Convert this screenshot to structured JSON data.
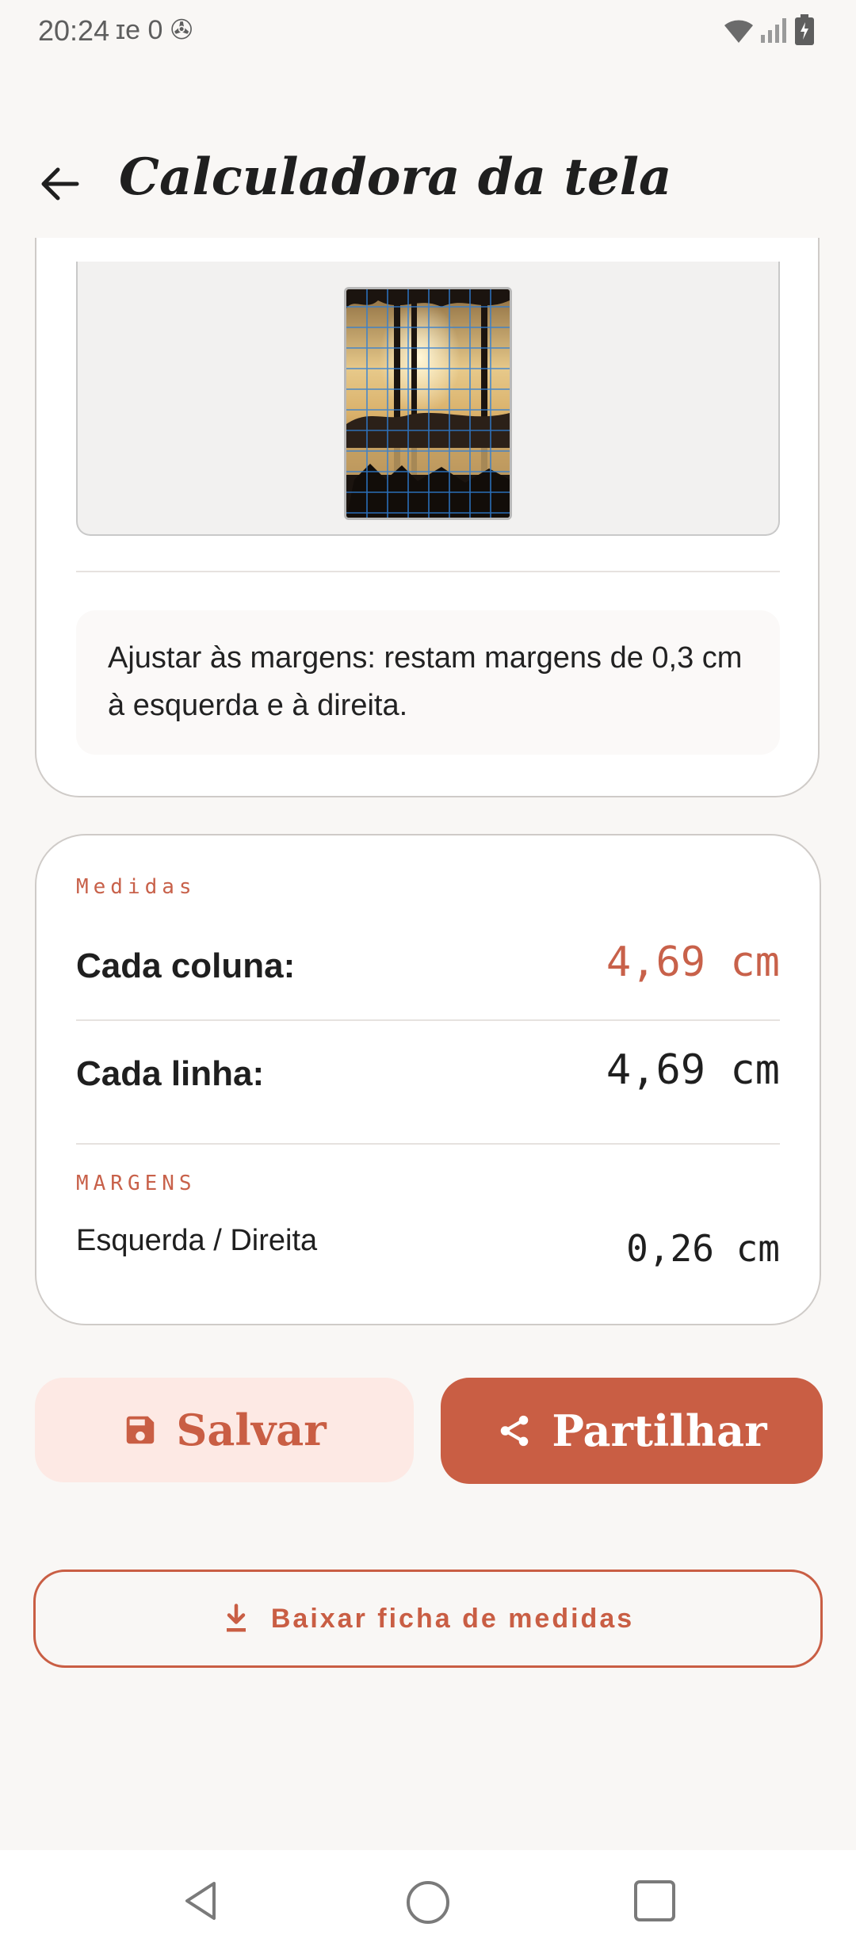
{
  "status_bar": {
    "time": "20:24",
    "left_icons": "ɪe 0 ✇"
  },
  "app_bar": {
    "title": "Calculadora da tela"
  },
  "fit_note": {
    "text": "Ajustar às margens: restam margens de 0,3 cm à esquerda e à direita."
  },
  "measures": {
    "overline": "Medidas",
    "column_label": "Cada coluna:",
    "column_value": "4,69 cm",
    "row_label": "Cada linha:",
    "row_value": "4,69 cm",
    "margins_overline": "MARGENS",
    "margins_label": "Esquerda / Direita",
    "margins_value": "0,26 cm"
  },
  "actions": {
    "save_label": "Salvar",
    "share_label": "Partilhar",
    "download_label": "Baixar ficha de medidas"
  },
  "colors": {
    "accent": "#c95e44",
    "accent_light": "#fde9e4",
    "grid_line": "#2f7fd6"
  },
  "icons": {
    "back": "arrow-left-icon",
    "save": "floppy-disk-icon",
    "share": "share-icon",
    "download": "download-icon",
    "nav_back": "triangle-back-icon",
    "nav_home": "circle-home-icon",
    "nav_recents": "square-recents-icon"
  }
}
